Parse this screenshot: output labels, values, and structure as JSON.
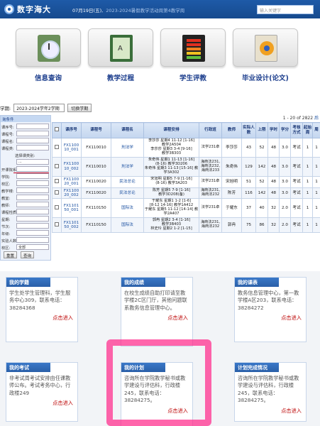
{
  "header": {
    "logo_text": "数字海大",
    "date_text": "07月19日(五),",
    "date_hint": "2023-2024暑假教学活动周第4教学周",
    "search_placeholder": "输入关键字"
  },
  "modules": [
    {
      "label": "信息查询",
      "icon": "clock-icon"
    },
    {
      "label": "教学过程",
      "icon": "book-icon"
    },
    {
      "label": "学生评教",
      "icon": "bar-chart-icon"
    },
    {
      "label": "毕业设计(论文)",
      "icon": "award-icon"
    }
  ],
  "semester": {
    "label": "学期:",
    "selected": "2023-2024学年2学期",
    "switch_label": "切换学期"
  },
  "filter": {
    "title": "询条件",
    "fields": [
      {
        "label": "课序号:",
        "value": ""
      },
      {
        "label": "课程号:",
        "value": ""
      },
      {
        "label": "课程名:",
        "value": ""
      },
      {
        "label": "课程类:",
        "value": ""
      },
      {
        "label": "选择课类别:",
        "value": ""
      },
      {
        "label": "",
        "value": "..."
      },
      {
        "label": "开课院系:",
        "value": ""
      },
      {
        "label": "学院:",
        "value": ""
      },
      {
        "label": "校区:",
        "value": ""
      },
      {
        "label": "教学楼:",
        "value": ""
      },
      {
        "label": "教室:",
        "value": ""
      },
      {
        "label": "教师:",
        "value": ""
      },
      {
        "label": "课程性质:",
        "value": ""
      },
      {
        "label": "星期:",
        "value": ""
      },
      {
        "label": "节次:",
        "value": ""
      },
      {
        "label": "年级:",
        "value": ""
      },
      {
        "label": "实验人数:",
        "value": ""
      },
      {
        "label": "校区:",
        "value": "全部"
      }
    ],
    "reset_label": "重置",
    "query_label": "查询"
  },
  "table": {
    "pager": "1 - 20 of 2822",
    "pager_link": "后",
    "headers": [
      "",
      "课序号",
      "课程号",
      "课程名",
      "课程安排",
      "行政班",
      "教师",
      "实际人数",
      "上限",
      "学时",
      "学分",
      "考核方式",
      "起始周",
      "周"
    ],
    "rows": [
      {
        "seq": "FX1100\n10_001",
        "code": "FX110010",
        "name": "刑法学",
        "arrangement": "李莎莎 星期4 11-12 [1-16]\n教学2A504\n李莎莎 星期3 3-4 [9-16]\n教学3B303",
        "class": "法学231卓",
        "teacher": "李莎莎",
        "actual": "43",
        "limit": "52",
        "hours": "48",
        "credit": "3.0",
        "exam": "考试",
        "start": "1",
        "week": "1"
      },
      {
        "seq": "FX1100\n10_002",
        "code": "FX110010",
        "name": "刑法学",
        "arrangement": "朱奇伟 星期1 11-13 [1-16]\n(8-16) 教学3D206\n朱奇伟 星期3 11-13 [15-16] 教学3A302",
        "class": "海商法231,\n海商法232,\n海商法233",
        "teacher": "朱奇伟",
        "actual": "129",
        "limit": "142",
        "hours": "48",
        "credit": "3.0",
        "exam": "考试",
        "start": "1",
        "week": "1"
      },
      {
        "seq": "FX1100\n20_001",
        "code": "FX110020",
        "name": "民法总论",
        "arrangement": "宋旭明 星期5 7-9 [1-16]\n(8-16) 教学3A203",
        "class": "法学231卓",
        "teacher": "宋旭明",
        "actual": "51",
        "limit": "52",
        "hours": "48",
        "credit": "3.0",
        "exam": "考试",
        "start": "1",
        "week": "1"
      },
      {
        "seq": "FX1100\n20_002",
        "code": "FX110020",
        "name": "民法总论",
        "arrangement": "陈芳 星期5 7-9 [1-16]\n教学3D208(备)",
        "class": "海商法231,\n海商法232",
        "teacher": "陈芳",
        "actual": "116",
        "limit": "142",
        "hours": "48",
        "credit": "3.0",
        "exam": "考试",
        "start": "1",
        "week": "1"
      },
      {
        "seq": "FX1101\n50_001",
        "code": "FX110150",
        "name": "国际法",
        "arrangement": "于耀东 星期1 1-2 [1-6]\n[8-12 14-16] 教学1A412\n于耀东 星期5 11-12 [14-14] 教学2A407",
        "class": "法学231卓",
        "teacher": "于耀东",
        "actual": "37",
        "limit": "40",
        "hours": "32",
        "credit": "2.0",
        "exam": "考试",
        "start": "1",
        "week": "1"
      },
      {
        "seq": "FX1101\n50_002",
        "code": "FX110150",
        "name": "国际法",
        "arrangement": "郭冉 星期2 3-4 [1-16]\n教学3B403\n林史玲 星期2 1-2 [1-15]",
        "class": "海商法231,\n海商法232",
        "teacher": "郭冉",
        "actual": "75",
        "limit": "86",
        "hours": "32",
        "credit": "2.0",
        "exam": "考试",
        "start": "1",
        "week": "1"
      }
    ]
  },
  "info_boxes": [
    {
      "title": "我的学籍",
      "text": "学生处学生管理科，学生服务中心309，联系电话：38284368",
      "link": "点击进入"
    },
    {
      "title": "我的成绩",
      "text": "在校生成绩自助打印请至教学楼2C区门厅，其他问题联系教务信息管理中心。",
      "link": "点击进入"
    },
    {
      "title": "我的课表",
      "text": "教务信息管理中心，第一教学楼A区203，联系电话：38284272",
      "link": "点击进入"
    },
    {
      "title": "我的考试",
      "text": "非考试周考试安排由任课教师公布。考试考务中心，行政楼249",
      "link": "点击进入"
    },
    {
      "title": "我的计划",
      "text": "咨询所在学院教学秘书或教学建设与评估科，行政楼245，联系电话：38284275。",
      "link": "点击进入"
    },
    {
      "title": "计划完成情况",
      "text": "咨询所在学院教学秘书或教学建设与评估科，行政楼245，联系电话：38284275。",
      "link": "点击进入"
    }
  ],
  "colors": {
    "header_blue": "#1e5aa8",
    "link_blue": "#1a4fa0",
    "accent_red": "#b00000",
    "highlight_pink": "#ff2a8a"
  }
}
